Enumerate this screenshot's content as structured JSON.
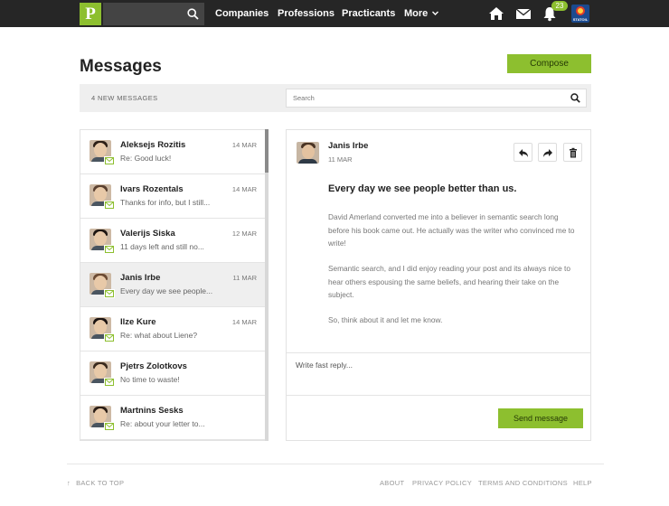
{
  "nav": {
    "logo": "P",
    "links": [
      "Companies",
      "Professions",
      "Practicants",
      "More"
    ],
    "notification_count": "23",
    "avatar_label": "STATOIL"
  },
  "header": {
    "title": "Messages",
    "compose_label": "Compose"
  },
  "toolbar": {
    "new_count": "4 NEW MESSAGES",
    "search_placeholder": "Search"
  },
  "inbox": [
    {
      "name": "Aleksejs Rozitis",
      "date": "14 MAR",
      "preview": "Re: Good luck!",
      "active": false
    },
    {
      "name": "Ivars Rozentals",
      "date": "14 MAR",
      "preview": "Thanks for info, but I still...",
      "active": false
    },
    {
      "name": "Valerijs Siska",
      "date": "12 MAR",
      "preview": "11 days left and still no...",
      "active": false
    },
    {
      "name": "Janis Irbe",
      "date": "11 MAR",
      "preview": "Every day we see people...",
      "active": true
    },
    {
      "name": "Ilze Kure",
      "date": "14 MAR",
      "preview": "Re: what about Liene?",
      "active": false
    },
    {
      "name": "Pjetrs Zolotkovs",
      "date": "",
      "preview": "No time to waste!",
      "active": false
    },
    {
      "name": "Martnins Sesks",
      "date": "",
      "preview": "Re: about your letter to...",
      "active": false
    }
  ],
  "message": {
    "sender": "Janis Irbe",
    "date": "11 MAR",
    "subject": "Every day we see people better than us.",
    "paragraphs": [
      "David Amerland converted me into a believer in semantic search long before his book came out. He actually was the writer who convinced me to write!",
      "Semantic search, and I did enjoy reading your post and its always nice to hear others espousing the same beliefs, and hearing their take on the subject.",
      "So, think about it and let me know."
    ],
    "reply_placeholder": "Write fast reply...",
    "send_label": "Send message"
  },
  "footer": {
    "back_to_top": "BACK TO TOP",
    "links": [
      "ABOUT",
      "PRIVACY POLICY",
      "TERMS AND CONDITIONS",
      "HELP"
    ]
  }
}
